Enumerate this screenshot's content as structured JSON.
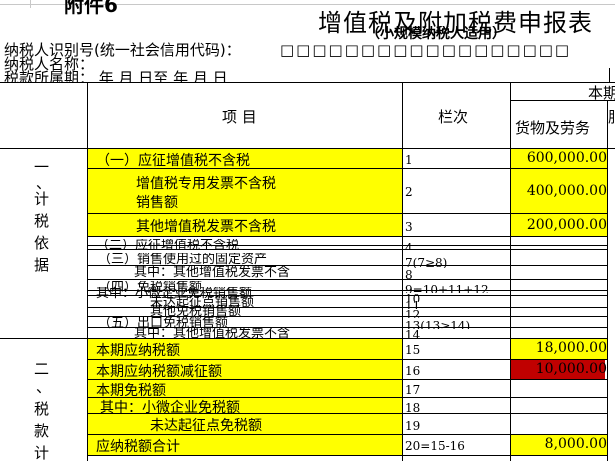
{
  "form": {
    "annex_label": "附件6",
    "title": "增值税及附加税费申报表",
    "subtitle": "（小规模纳税人适用）",
    "taxpayer_id_label": "纳税人识别号(统一社会信用代码)：",
    "taxpayer_id_boxes": "□□□□□□□□□□□□□□□□□□",
    "taxpayer_name_label": "纳税人名称：",
    "period_label": "税款所属期：      年  月  日至      年  月  日"
  },
  "table": {
    "header_item": "项    目",
    "header_line": "栏次",
    "header_current": "本期",
    "header_goods": "货物及劳务",
    "header_service_partial": "服务",
    "section1_label": "一、计税依据",
    "section1_chars": [
      "一",
      "、",
      "计",
      "税",
      "依",
      "据"
    ],
    "section2_chars": [
      "二",
      "、",
      "税",
      "款",
      "计"
    ],
    "rows": [
      {
        "item": "（一）应征增值税不含税",
        "line": "1",
        "amount": "600,000.00"
      },
      {
        "item": "增值税专用发票不含税",
        "item2": "销售额",
        "line": "2",
        "amount": "400,000.00"
      },
      {
        "item": "其他增值税发票不含税",
        "line": "3",
        "amount": "200,000.00"
      },
      {
        "item": "（二）应征增值税不含税",
        "line": "4",
        "amount": ""
      },
      {
        "item": "（三）销售使用过的固定资产",
        "line": "7(7≥8)",
        "amount": ""
      },
      {
        "item": "其中：其他增值税发票不含",
        "line": "8",
        "amount": ""
      },
      {
        "item": "（四）免税销售额",
        "line": "9=10+11+12",
        "amount": ""
      },
      {
        "item": "其中：小微企业免税销售额",
        "line": "10",
        "amount": ""
      },
      {
        "item": "未达起征点销售额",
        "line": "11",
        "amount": ""
      },
      {
        "item": "其他免税销售额",
        "line": "12",
        "amount": ""
      },
      {
        "item": "（五）出口免税销售额",
        "line": "13(13≥14)",
        "amount": ""
      },
      {
        "item": "其中：其他增值税发票不含",
        "line": "14",
        "amount": ""
      },
      {
        "item": "本期应纳税额",
        "line": "15",
        "amount": "18,000.00"
      },
      {
        "item": "本期应纳税额减征额",
        "line": "16",
        "amount": "10,000.00"
      },
      {
        "item": "本期免税额",
        "line": "17",
        "amount": ""
      },
      {
        "item": "其中：小微企业免税额",
        "line": "18",
        "amount": ""
      },
      {
        "item": "未达起征点免税额",
        "line": "19",
        "amount": ""
      },
      {
        "item": "应纳税额合计",
        "line": "20=15-16",
        "amount": "8,000.00"
      }
    ]
  },
  "colors": {
    "highlight": "#ffff00",
    "alert": "#c00000",
    "grid": "#000000"
  }
}
